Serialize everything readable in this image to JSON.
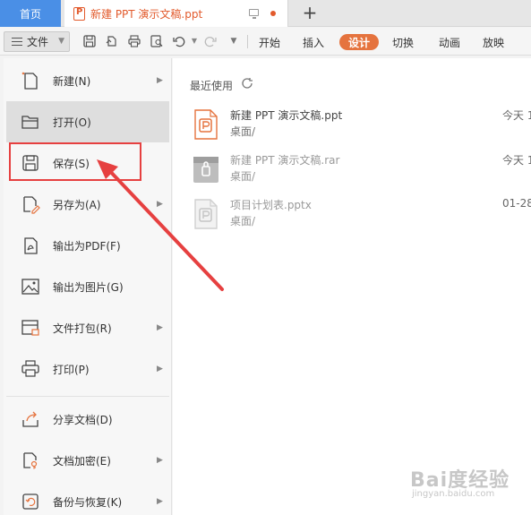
{
  "tabs": {
    "home": "首页",
    "document": "新建 PPT 演示文稿.ppt",
    "new_tab": "+"
  },
  "toolbar": {
    "file_label": "文件",
    "ribbon_tabs": [
      {
        "label": "开始",
        "active": false
      },
      {
        "label": "插入",
        "active": false
      },
      {
        "label": "设计",
        "active": true
      },
      {
        "label": "切换",
        "active": false
      },
      {
        "label": "动画",
        "active": false
      },
      {
        "label": "放映",
        "active": false
      }
    ]
  },
  "menu": {
    "items": [
      {
        "label": "新建(N)",
        "icon": "new-document-icon",
        "has_submenu": true
      },
      {
        "label": "打开(O)",
        "icon": "open-folder-icon",
        "has_submenu": false
      },
      {
        "label": "保存(S)",
        "icon": "save-icon",
        "has_submenu": false
      },
      {
        "label": "另存为(A)",
        "icon": "save-as-icon",
        "has_submenu": true
      },
      {
        "label": "输出为PDF(F)",
        "icon": "export-pdf-icon",
        "has_submenu": false
      },
      {
        "label": "输出为图片(G)",
        "icon": "export-image-icon",
        "has_submenu": false
      },
      {
        "label": "文件打包(R)",
        "icon": "package-icon",
        "has_submenu": true
      },
      {
        "label": "打印(P)",
        "icon": "print-icon",
        "has_submenu": true
      },
      {
        "label": "分享文档(D)",
        "icon": "share-icon",
        "has_submenu": false
      },
      {
        "label": "文档加密(E)",
        "icon": "encrypt-icon",
        "has_submenu": true
      },
      {
        "label": "备份与恢复(K)",
        "icon": "backup-icon",
        "has_submenu": true
      }
    ]
  },
  "recent": {
    "title": "最近使用",
    "files": [
      {
        "name": "新建 PPT 演示文稿.ppt",
        "path": "桌面/",
        "time": "今天 1",
        "icon": "ppt-file-icon"
      },
      {
        "name": "新建 PPT 演示文稿.rar",
        "path": "桌面/",
        "time": "今天 1",
        "icon": "rar-archive-icon"
      },
      {
        "name": "项目计划表.pptx",
        "path": "桌面/",
        "time": "01-28",
        "icon": "pptx-file-icon"
      }
    ]
  },
  "watermark": {
    "main": "Bai度经验",
    "sub": "jingyan.baidu.com"
  },
  "colors": {
    "accent_orange": "#e5733e",
    "tab_blue": "#4a8fe6",
    "annotation_red": "#e64040"
  }
}
